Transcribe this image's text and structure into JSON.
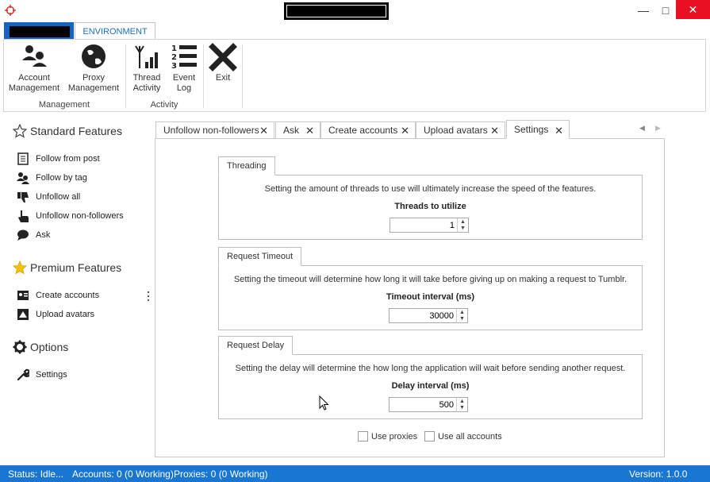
{
  "ribbon": {
    "tab_environment": "ENVIRONMENT",
    "buttons": {
      "account_management": "Account\nManagement",
      "proxy_management": "Proxy\nManagement",
      "thread_activity": "Thread\nActivity",
      "event_log": "Event\nLog",
      "exit": "Exit"
    },
    "group_management": "Management",
    "group_activity": "Activity"
  },
  "nav": {
    "standard_header": "Standard Features",
    "standard_items": [
      "Follow from post",
      "Follow by tag",
      "Unfollow all",
      "Unfollow non-followers",
      "Ask"
    ],
    "premium_header": "Premium Features",
    "premium_items": [
      "Create accounts",
      "Upload avatars"
    ],
    "options_header": "Options",
    "options_items": [
      "Settings"
    ]
  },
  "tabs": [
    "Unfollow non-followers",
    "Ask",
    "Create accounts",
    "Upload avatars",
    "Settings"
  ],
  "settings": {
    "threading": {
      "title": "Threading",
      "description": "Setting the amount of threads to use will ultimately increase the speed of the features.",
      "label": "Threads to utilize",
      "value": "1"
    },
    "timeout": {
      "title": "Request Timeout",
      "description": "Setting the timeout will determine how long it will take before giving up on making a request to Tumblr.",
      "label": "Timeout interval (ms)",
      "value": "30000"
    },
    "delay": {
      "title": "Request Delay",
      "description": "Setting the delay will determine the how long the application will wait before sending another request.",
      "label": "Delay interval (ms)",
      "value": "500"
    },
    "use_proxies": "Use proxies",
    "use_all_accounts": "Use all accounts"
  },
  "status": {
    "status": "Status: Idle...",
    "accounts": "Accounts: 0 (0 Working)",
    "proxies": "Proxies: 0 (0 Working)",
    "version": "Version: 1.0.0"
  },
  "colors": {
    "accent": "#1976d2",
    "close": "#e81123"
  }
}
